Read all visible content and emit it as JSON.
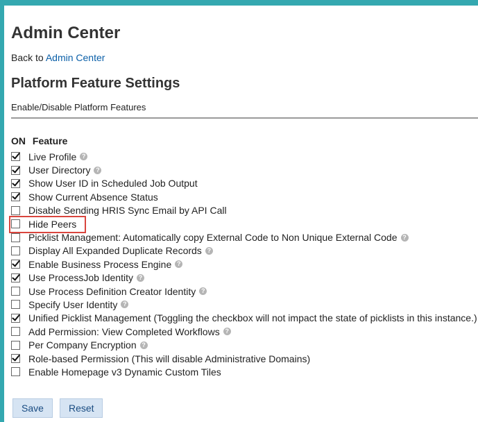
{
  "header": {
    "title": "Admin Center",
    "back_prefix": "Back to",
    "back_link": "Admin Center"
  },
  "section": {
    "title": "Platform Feature Settings",
    "subtitle": "Enable/Disable Platform Features"
  },
  "table": {
    "col_on": "ON",
    "col_feature": "Feature"
  },
  "features": [
    {
      "label": "Live Profile",
      "checked": true,
      "help": true
    },
    {
      "label": "User Directory",
      "checked": true,
      "help": true
    },
    {
      "label": "Show User ID in Scheduled Job Output",
      "checked": true,
      "help": false
    },
    {
      "label": "Show Current Absence Status",
      "checked": true,
      "help": false
    },
    {
      "label": "Disable Sending HRIS Sync Email by API Call",
      "checked": false,
      "help": false
    },
    {
      "label": "Hide Peers",
      "checked": false,
      "help": false,
      "highlighted": true
    },
    {
      "label": "Picklist Management: Automatically copy External Code to Non Unique External Code",
      "checked": false,
      "help": true
    },
    {
      "label": "Display All Expanded Duplicate Records",
      "checked": false,
      "help": true
    },
    {
      "label": "Enable Business Process Engine",
      "checked": true,
      "help": true
    },
    {
      "label": "Use ProcessJob Identity",
      "checked": true,
      "help": true
    },
    {
      "label": "Use Process Definition Creator Identity",
      "checked": false,
      "help": true
    },
    {
      "label": "Specify User Identity",
      "checked": false,
      "help": true
    },
    {
      "label": "Unified Picklist Management (Toggling the checkbox will not impact the state of picklists in this instance.)",
      "checked": true,
      "help": false
    },
    {
      "label": "Add Permission: View Completed Workflows",
      "checked": false,
      "help": true
    },
    {
      "label": "Per Company Encryption",
      "checked": false,
      "help": true
    },
    {
      "label": "Role-based Permission (This will disable Administrative Domains)",
      "checked": true,
      "help": false
    },
    {
      "label": "Enable Homepage v3 Dynamic Custom Tiles",
      "checked": false,
      "help": false
    }
  ],
  "buttons": {
    "save": "Save",
    "reset": "Reset"
  },
  "icons": {
    "help": "question-mark-icon",
    "help_glyph": "?"
  },
  "colors": {
    "background": "#34a8b0",
    "link": "#0a5fa8",
    "highlight": "#d9453d",
    "button": "#d6e4f3"
  }
}
